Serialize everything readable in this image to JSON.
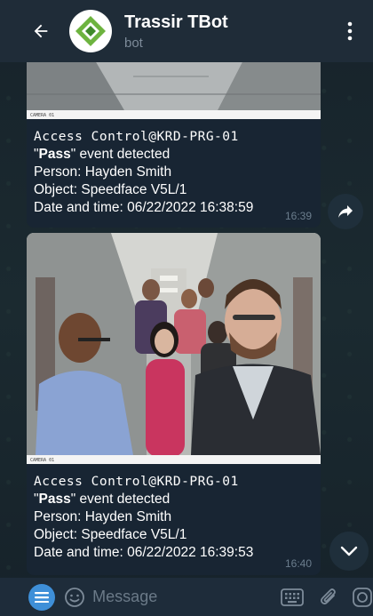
{
  "header": {
    "title": "Trassir TBot",
    "subtitle": "bot"
  },
  "messages": [
    {
      "device": "Access Control@KRD-PRG-01",
      "event_bold": "Pass",
      "event_rest": " event detected",
      "person": "Person: Hayden Smith",
      "object": "Object: Speedface V5L/1",
      "datetime": "Date and time: 06/22/2022 16:38:59",
      "time": "16:39"
    },
    {
      "device": "Access Control@KRD-PRG-01",
      "event_bold": "Pass",
      "event_rest": " event detected",
      "person": "Person: Hayden Smith",
      "object": "Object: Speedface V5L/1",
      "datetime": "Date and time: 06/22/2022 16:39:53",
      "time": "16:40"
    }
  ],
  "input": {
    "placeholder": "Message"
  }
}
